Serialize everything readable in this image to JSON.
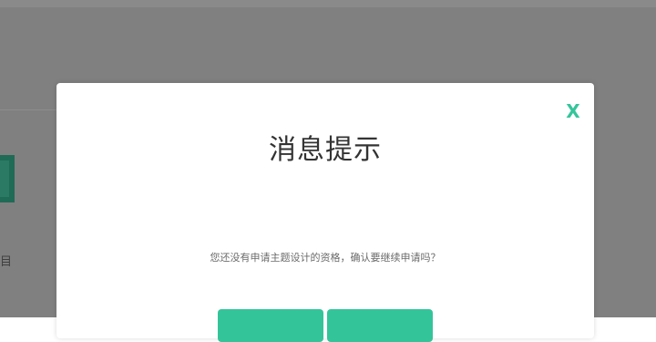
{
  "dialog": {
    "title": "消息提示",
    "message": "您还没有申请主题设计的资格，确认要继续申请吗？",
    "close_glyph": "X",
    "buttons": {
      "confirm": "",
      "cancel": ""
    }
  },
  "icons": {
    "close": "close-icon"
  },
  "colors": {
    "accent": "#33c49a",
    "overlay": "#808080",
    "title_text": "#333333"
  }
}
